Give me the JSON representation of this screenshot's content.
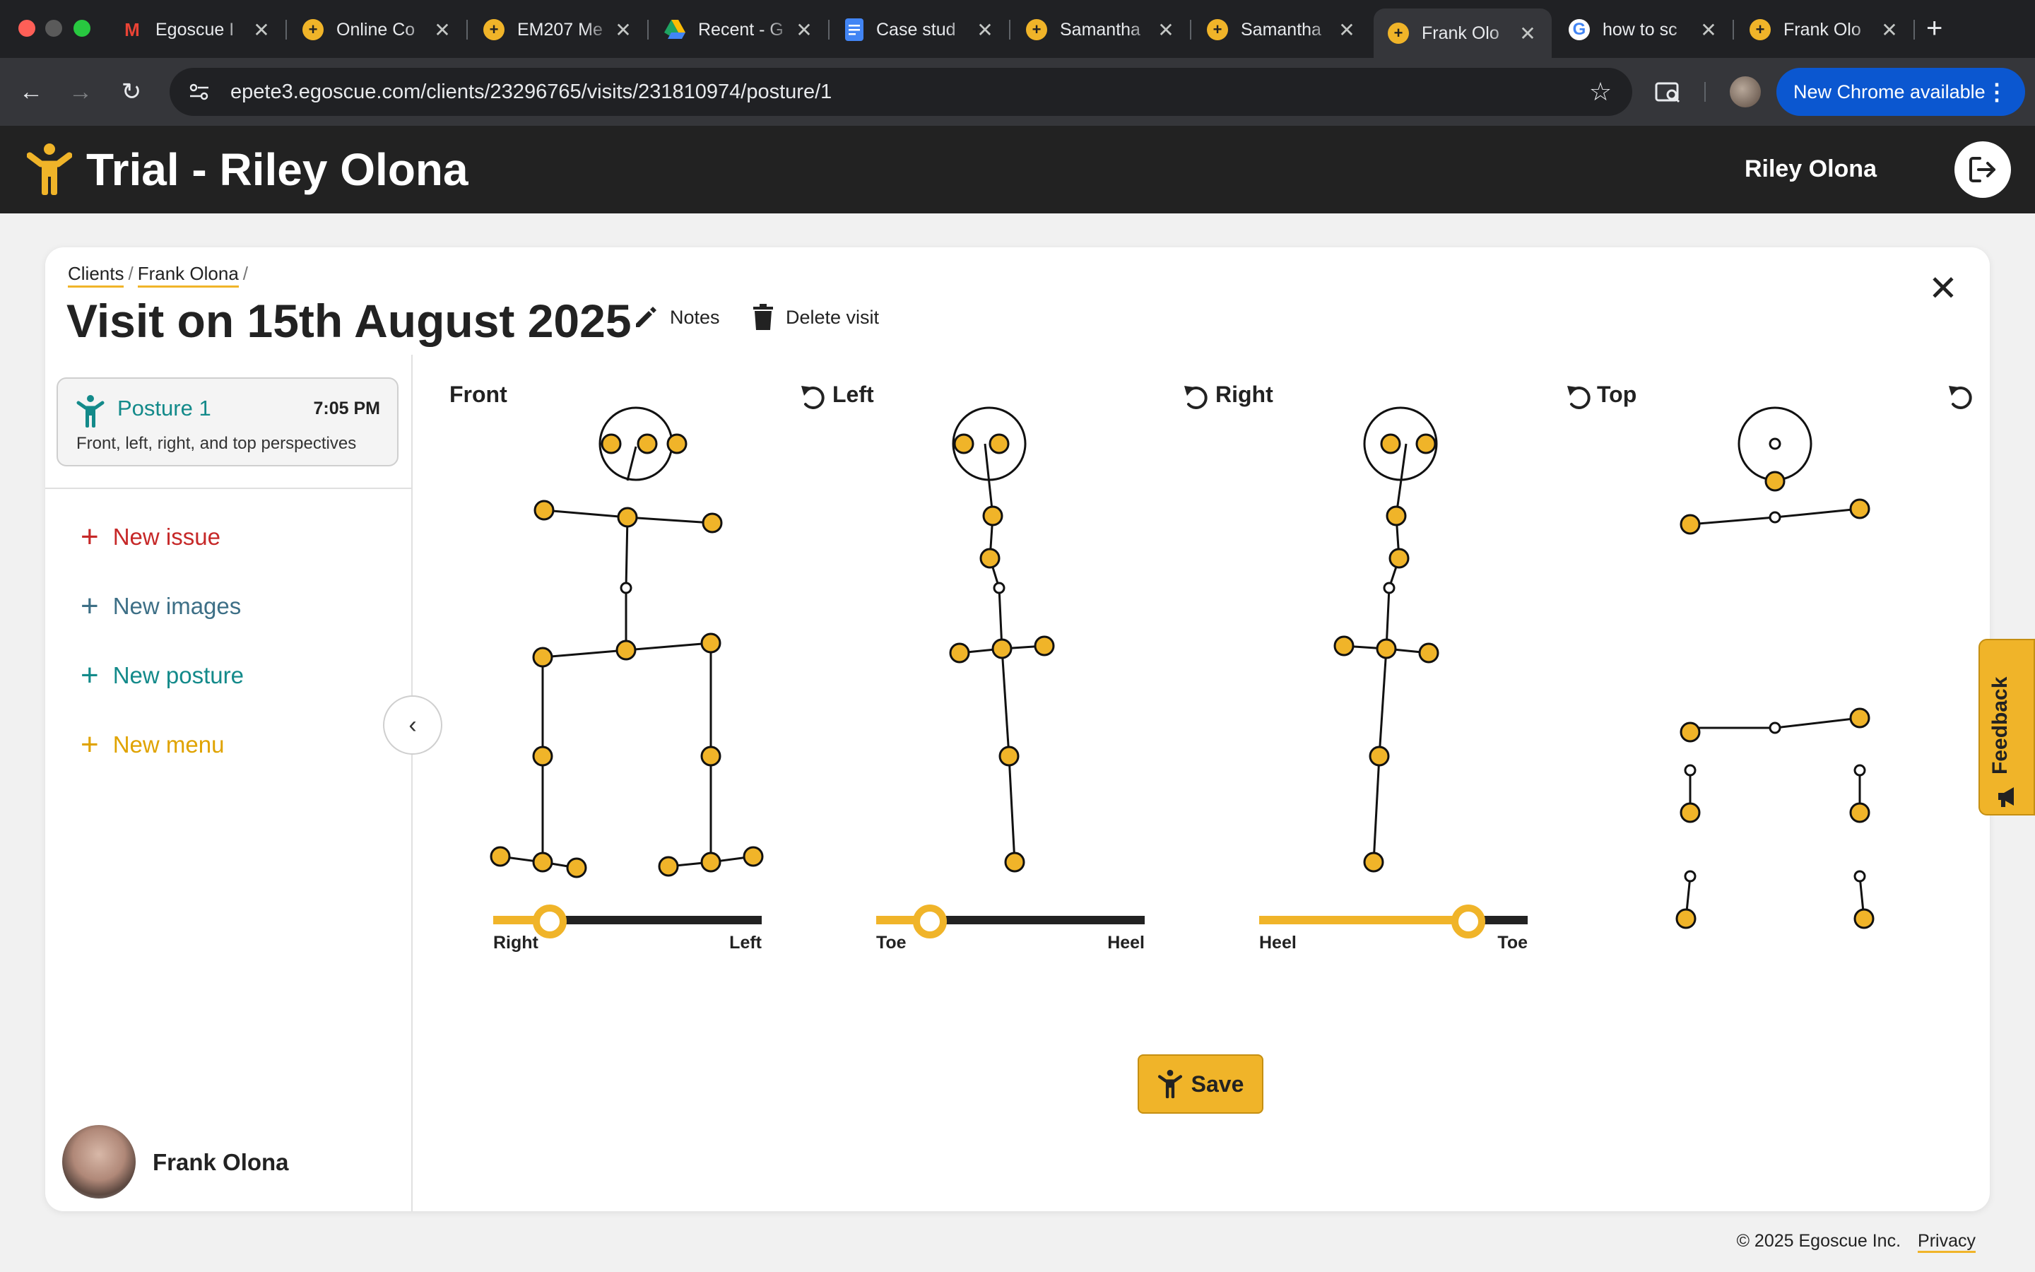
{
  "browser": {
    "tabs": [
      {
        "title": "Egoscue I",
        "favicon": "gmail-icon",
        "active": false
      },
      {
        "title": "Online Co",
        "favicon": "egoscue-icon",
        "active": false
      },
      {
        "title": "EM207 Me",
        "favicon": "egoscue-icon",
        "active": false
      },
      {
        "title": "Recent - G",
        "favicon": "drive-icon",
        "active": false
      },
      {
        "title": "Case stud",
        "favicon": "docs-icon",
        "active": false
      },
      {
        "title": "Samantha",
        "favicon": "egoscue-icon",
        "active": false
      },
      {
        "title": "Samantha",
        "favicon": "egoscue-icon",
        "active": false
      },
      {
        "title": "Frank Olo",
        "favicon": "egoscue-icon",
        "active": true
      },
      {
        "title": "how to sc",
        "favicon": "google-icon",
        "active": false
      },
      {
        "title": "Frank Olo",
        "favicon": "egoscue-icon",
        "active": false
      }
    ],
    "url": "epete3.egoscue.com/clients/23296765/visits/231810974/posture/1",
    "update_button": "New Chrome available"
  },
  "app": {
    "title": "Trial - Riley Olona",
    "user_name": "Riley Olona",
    "accent_color": "#f0b429"
  },
  "breadcrumb": {
    "clients": "Clients",
    "client": "Frank Olona"
  },
  "visit": {
    "title": "Visit on 15th August 2025",
    "notes_label": "Notes",
    "delete_label": "Delete visit"
  },
  "sidebar": {
    "posture": {
      "name": "Posture 1",
      "time": "7:05 PM",
      "description": "Front, left, right, and top perspectives"
    },
    "links": [
      {
        "label": "New issue",
        "color": "#c62828"
      },
      {
        "label": "New images",
        "color": "#3d6f86"
      },
      {
        "label": "New posture",
        "color": "#138a8a"
      },
      {
        "label": "New menu",
        "color": "#e0a300"
      }
    ],
    "client_name": "Frank Olona"
  },
  "perspectives": [
    {
      "label": "Front",
      "slider": {
        "left": "Right",
        "right": "Left",
        "value": 0.21
      }
    },
    {
      "label": "Left",
      "slider": {
        "left": "Toe",
        "right": "Heel",
        "value": 0.2
      }
    },
    {
      "label": "Right",
      "slider": {
        "left": "Heel",
        "right": "Toe",
        "value": 0.78
      }
    },
    {
      "label": "Top"
    }
  ],
  "save_label": "Save",
  "feedback_label": "Feedback",
  "footer": {
    "copyright": "© 2025 Egoscue Inc.",
    "privacy": "Privacy"
  }
}
